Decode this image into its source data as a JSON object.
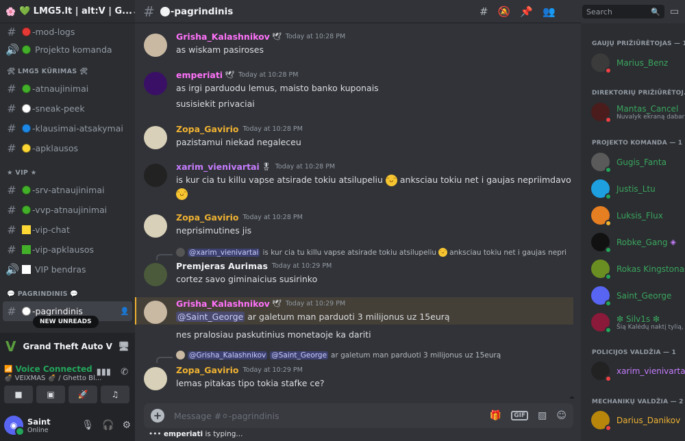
{
  "server": {
    "name": "💚 LMG5.lt | alt:V | G...",
    "chevron": "chevron-down-icon"
  },
  "channels_top": [
    {
      "name": "-mod-logs",
      "color": "#e53935",
      "kind": "text"
    },
    {
      "name": "Projekto komanda",
      "color": "#43b02a",
      "kind": "voice"
    }
  ],
  "categories": {
    "kurimas": "🛠 LMG5 KŪRIMAS 🛠",
    "vip": "★ VIP ★",
    "pagrindinis": "💬 PAGRINDINIS 💬"
  },
  "channels_kurimas": [
    {
      "name": "-atnaujinimai",
      "color": "#43b02a"
    },
    {
      "name": "-sneak-peek",
      "color": "#ffffff"
    },
    {
      "name": "-klausimai-atsakymai",
      "color": "#1e88e5"
    },
    {
      "name": "-apklausos",
      "color": "#fdd835"
    }
  ],
  "channels_vip": [
    {
      "name": "-srv-atnaujinimai",
      "color": "#43b02a",
      "shape": "circle",
      "kind": "text"
    },
    {
      "name": "-vvp-atnaujinimai",
      "color": "#43b02a",
      "shape": "circle",
      "kind": "text"
    },
    {
      "name": "-vip-chat",
      "color": "#fdd835",
      "shape": "square",
      "kind": "text"
    },
    {
      "name": "-vip-apklausos",
      "color": "#43b02a",
      "shape": "square",
      "kind": "text"
    },
    {
      "name": "VIP bendras",
      "color": "#ffffff",
      "shape": "square",
      "kind": "voice"
    }
  ],
  "new_unreads": "NEW UNREADS",
  "game_activity": {
    "title": "Grand Theft Auto V"
  },
  "voice": {
    "title": "Voice Connected",
    "subtitle": "💣 VEIXMAS 💣 / Ghetto Bl..."
  },
  "user": {
    "name": "Saint",
    "status": "Online"
  },
  "channel": {
    "name": "-pagrindinis"
  },
  "search": {
    "placeholder": "Search"
  },
  "messages": [
    {
      "author": "Grisha_Kalashnikov",
      "color": "#ff73fa",
      "badge": "🕊",
      "time": "Today at 10:28 PM",
      "lines": [
        "as wiskam pasiroses"
      ]
    },
    {
      "author": "emperiati",
      "color": "#ff73fa",
      "badge": "🕊",
      "time": "Today at 10:28 PM",
      "lines": [
        "as irgi parduodu lemus, maisto banko kuponais",
        "susisiekit privaciai"
      ]
    },
    {
      "author": "Zopa_Gavirio",
      "color": "#f0b232",
      "badge": "",
      "time": "Today at 10:28 PM",
      "lines": [
        "pazistamui niekad negaleceu"
      ]
    },
    {
      "author": "xarim_vienivartai",
      "color": "#c77dff",
      "badge": "🎖",
      "time": "Today at 10:28 PM",
      "lines": [
        "is kur cia tu killu vapse atsirade tokiu atsilupeliu",
        "anksciau tokiu net i gaujas nepriimdavo"
      ]
    },
    {
      "author": "Zopa_Gavirio",
      "color": "#f0b232",
      "badge": "",
      "time": "Today at 10:28 PM",
      "lines": [
        "neprisimutines jis"
      ]
    },
    {
      "author": "Premjeras Aurimas",
      "color": "#f2f3f5",
      "badge": "",
      "time": "Today at 10:29 PM",
      "lines": [
        "cortez savo giminaicius susirinko"
      ],
      "reply": {
        "author": "@xarim_vienivartai",
        "text": "is kur cia tu killu vapse atsirade tokiu atsilupeliu",
        "text2": "anksciau tokiu net i gaujas nepri"
      }
    },
    {
      "author": "Grisha_Kalashnikov",
      "color": "#ff73fa",
      "badge": "🕊",
      "time": "Today at 10:29 PM",
      "mention": "@Saint_George",
      "lines": [
        "ar galetum man parduoti 3 milijonus uz 15eurą",
        "nes pralosiau paskutinius monetaoje ka dariti"
      ]
    },
    {
      "author": "Zopa_Gavirio",
      "color": "#f0b232",
      "badge": "",
      "time": "Today at 10:29 PM",
      "lines": [
        "lemas pitakas tipo tokia stafke ce?"
      ],
      "reply": {
        "author": "@Grisha_Kalashnikov",
        "mention": "@Saint_George",
        "text": "ar galetum man parduoti 3 milijonus uz 15eurą"
      }
    }
  ],
  "composer": {
    "placeholder": "Message #⚪-pagrindinis"
  },
  "typing": {
    "user": "emperiati",
    "text": " is typing..."
  },
  "member_groups": [
    {
      "title": "GAUJŲ PRIŽIŪRĖTOJAS — 1",
      "members": [
        {
          "name": "Marius_Benz",
          "color": "#3ba55d",
          "status": "#f23f43",
          "sub": ""
        }
      ]
    },
    {
      "title": "DIREKTORIŲ PRIŽIŪRĖTOJ...",
      "members": [
        {
          "name": "Mantas_Cancel",
          "color": "#3ba55d",
          "status": "#f23f43",
          "sub": "Nuvalyk ekraną dabar"
        }
      ]
    },
    {
      "title": "PROJEKTO KOMANDA — 1",
      "members": [
        {
          "name": "Gugis_Fanta",
          "color": "#3ba55d",
          "status": "#23a55a",
          "sub": ""
        },
        {
          "name": "Justis_Ltu",
          "color": "#3ba55d",
          "status": "#23a55a",
          "sub": ""
        },
        {
          "name": "Luksis_Flux",
          "color": "#3ba55d",
          "status": "#f0b232",
          "sub": ""
        },
        {
          "name": "Robke_Gang",
          "color": "#3ba55d",
          "status": "#23a55a",
          "sub": ""
        },
        {
          "name": "Rokas Kingstonas",
          "color": "#3ba55d",
          "status": "#23a55a",
          "sub": ""
        },
        {
          "name": "Saint_George",
          "color": "#3ba55d",
          "status": "#23a55a",
          "sub": ""
        },
        {
          "name": "❇ Silv1s ❇",
          "color": "#3ba55d",
          "status": "#23a55a",
          "sub": "Šią Kalėdų naktį tylią, v..."
        }
      ]
    },
    {
      "title": "POLICIJOS VALDŽIA — 1",
      "members": [
        {
          "name": "xarim_vienivartai",
          "color": "#c77dff",
          "status": "#f23f43",
          "sub": ""
        }
      ]
    },
    {
      "title": "MECHANIKŲ VALDŽIA — 2",
      "members": [
        {
          "name": "Darius_Danikov",
          "color": "#f0b232",
          "status": "#f23f43",
          "sub": ""
        }
      ]
    }
  ]
}
